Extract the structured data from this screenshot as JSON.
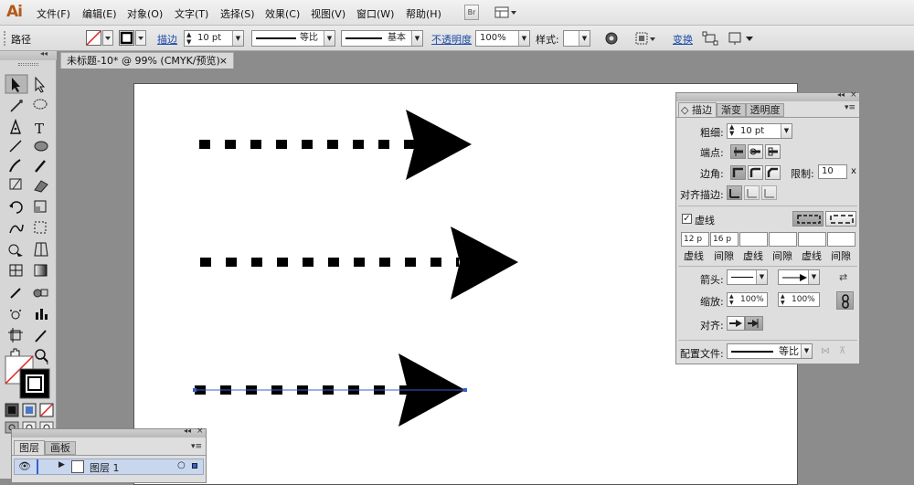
{
  "app": {
    "logo": "Ai"
  },
  "menu": [
    "文件(F)",
    "编辑(E)",
    "对象(O)",
    "文字(T)",
    "选择(S)",
    "效果(C)",
    "视图(V)",
    "窗口(W)",
    "帮助(H)"
  ],
  "menubar_extra": {
    "bridge_label": "Br"
  },
  "control": {
    "object_label": "路径",
    "stroke_link": "描边",
    "stroke_weight": "10 pt",
    "profile_label": "等比",
    "brush_label": "基本",
    "opacity_link": "不透明度",
    "opacity_value": "100%",
    "style_label": "样式:",
    "transform_link": "变换"
  },
  "document": {
    "tab_title": "未标题-10* @ 99% (CMYK/预览)",
    "close_glyph": "×"
  },
  "stroke_panel": {
    "tabs": [
      "◇ 描边",
      "渐变",
      "透明度"
    ],
    "weight_label": "粗细:",
    "weight_value": "10 pt",
    "cap_label": "端点:",
    "corner_label": "边角:",
    "limit_label": "限制:",
    "limit_value": "10",
    "limit_unit": "x",
    "align_label": "对齐描边:",
    "dashed_label": "虚线",
    "dashed_checked": true,
    "dash_values": [
      "12 p",
      "16 p",
      "",
      "",
      "",
      ""
    ],
    "dash_labels": [
      "虚线",
      "间隙",
      "虚线",
      "间隙",
      "虚线",
      "间隙"
    ],
    "arrow_label": "箭头:",
    "scale_label": "缩放:",
    "scale_start": "100%",
    "scale_end": "100%",
    "arrow_align_label": "对齐:",
    "profile_label": "配置文件:",
    "profile_value": "等比"
  },
  "layers_panel": {
    "tabs": [
      "图层",
      "画板"
    ],
    "layer_name": "图层 1"
  },
  "colors": {
    "accent_orange": "#b45a18",
    "path_blue": "#3a5fcd",
    "link_blue": "#1a4aa8"
  }
}
